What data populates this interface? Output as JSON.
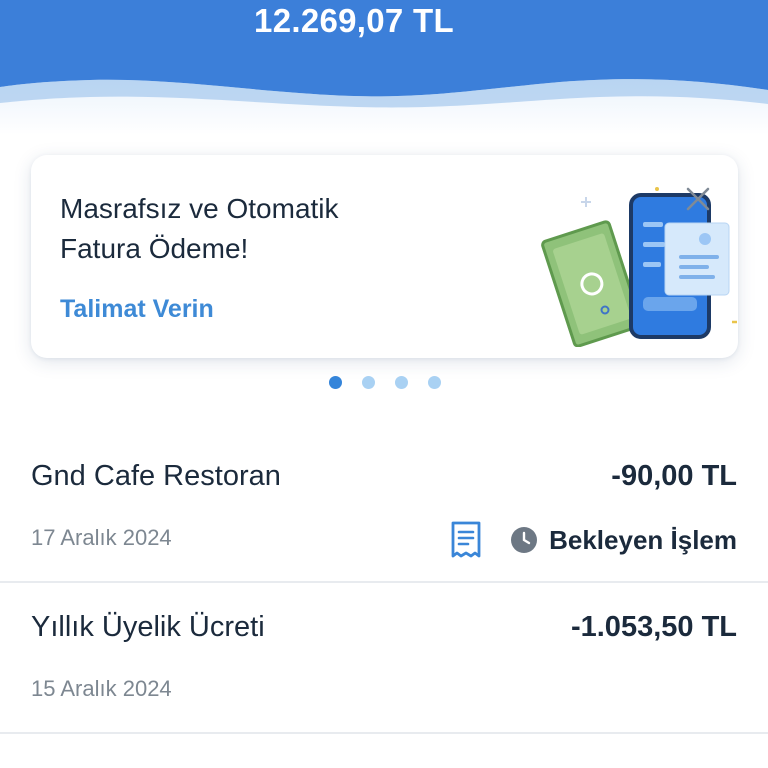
{
  "header": {
    "balance": "12.269,07 TL",
    "background_color": "#3c7fd9"
  },
  "promo": {
    "title_line1": "Masrafsız ve Otomatik",
    "title_line2": "Fatura Ödeme!",
    "link_label": "Talimat Verin",
    "illustration": "phone-bill-payment-illustration",
    "close_icon": "close-icon",
    "link_color": "#3e8ad6"
  },
  "carousel": {
    "dot_count": 4,
    "active_index": 0
  },
  "transactions": [
    {
      "merchant": "Gnd Cafe Restoran",
      "amount": "-90,00 TL",
      "date": "17 Aralık 2024",
      "status": "Bekleyen İşlem",
      "icons": [
        "receipt-icon",
        "clock-icon"
      ]
    },
    {
      "merchant": "Yıllık Üyelik Ücreti",
      "amount": "-1.053,50 TL",
      "date": "15 Aralık 2024"
    }
  ]
}
